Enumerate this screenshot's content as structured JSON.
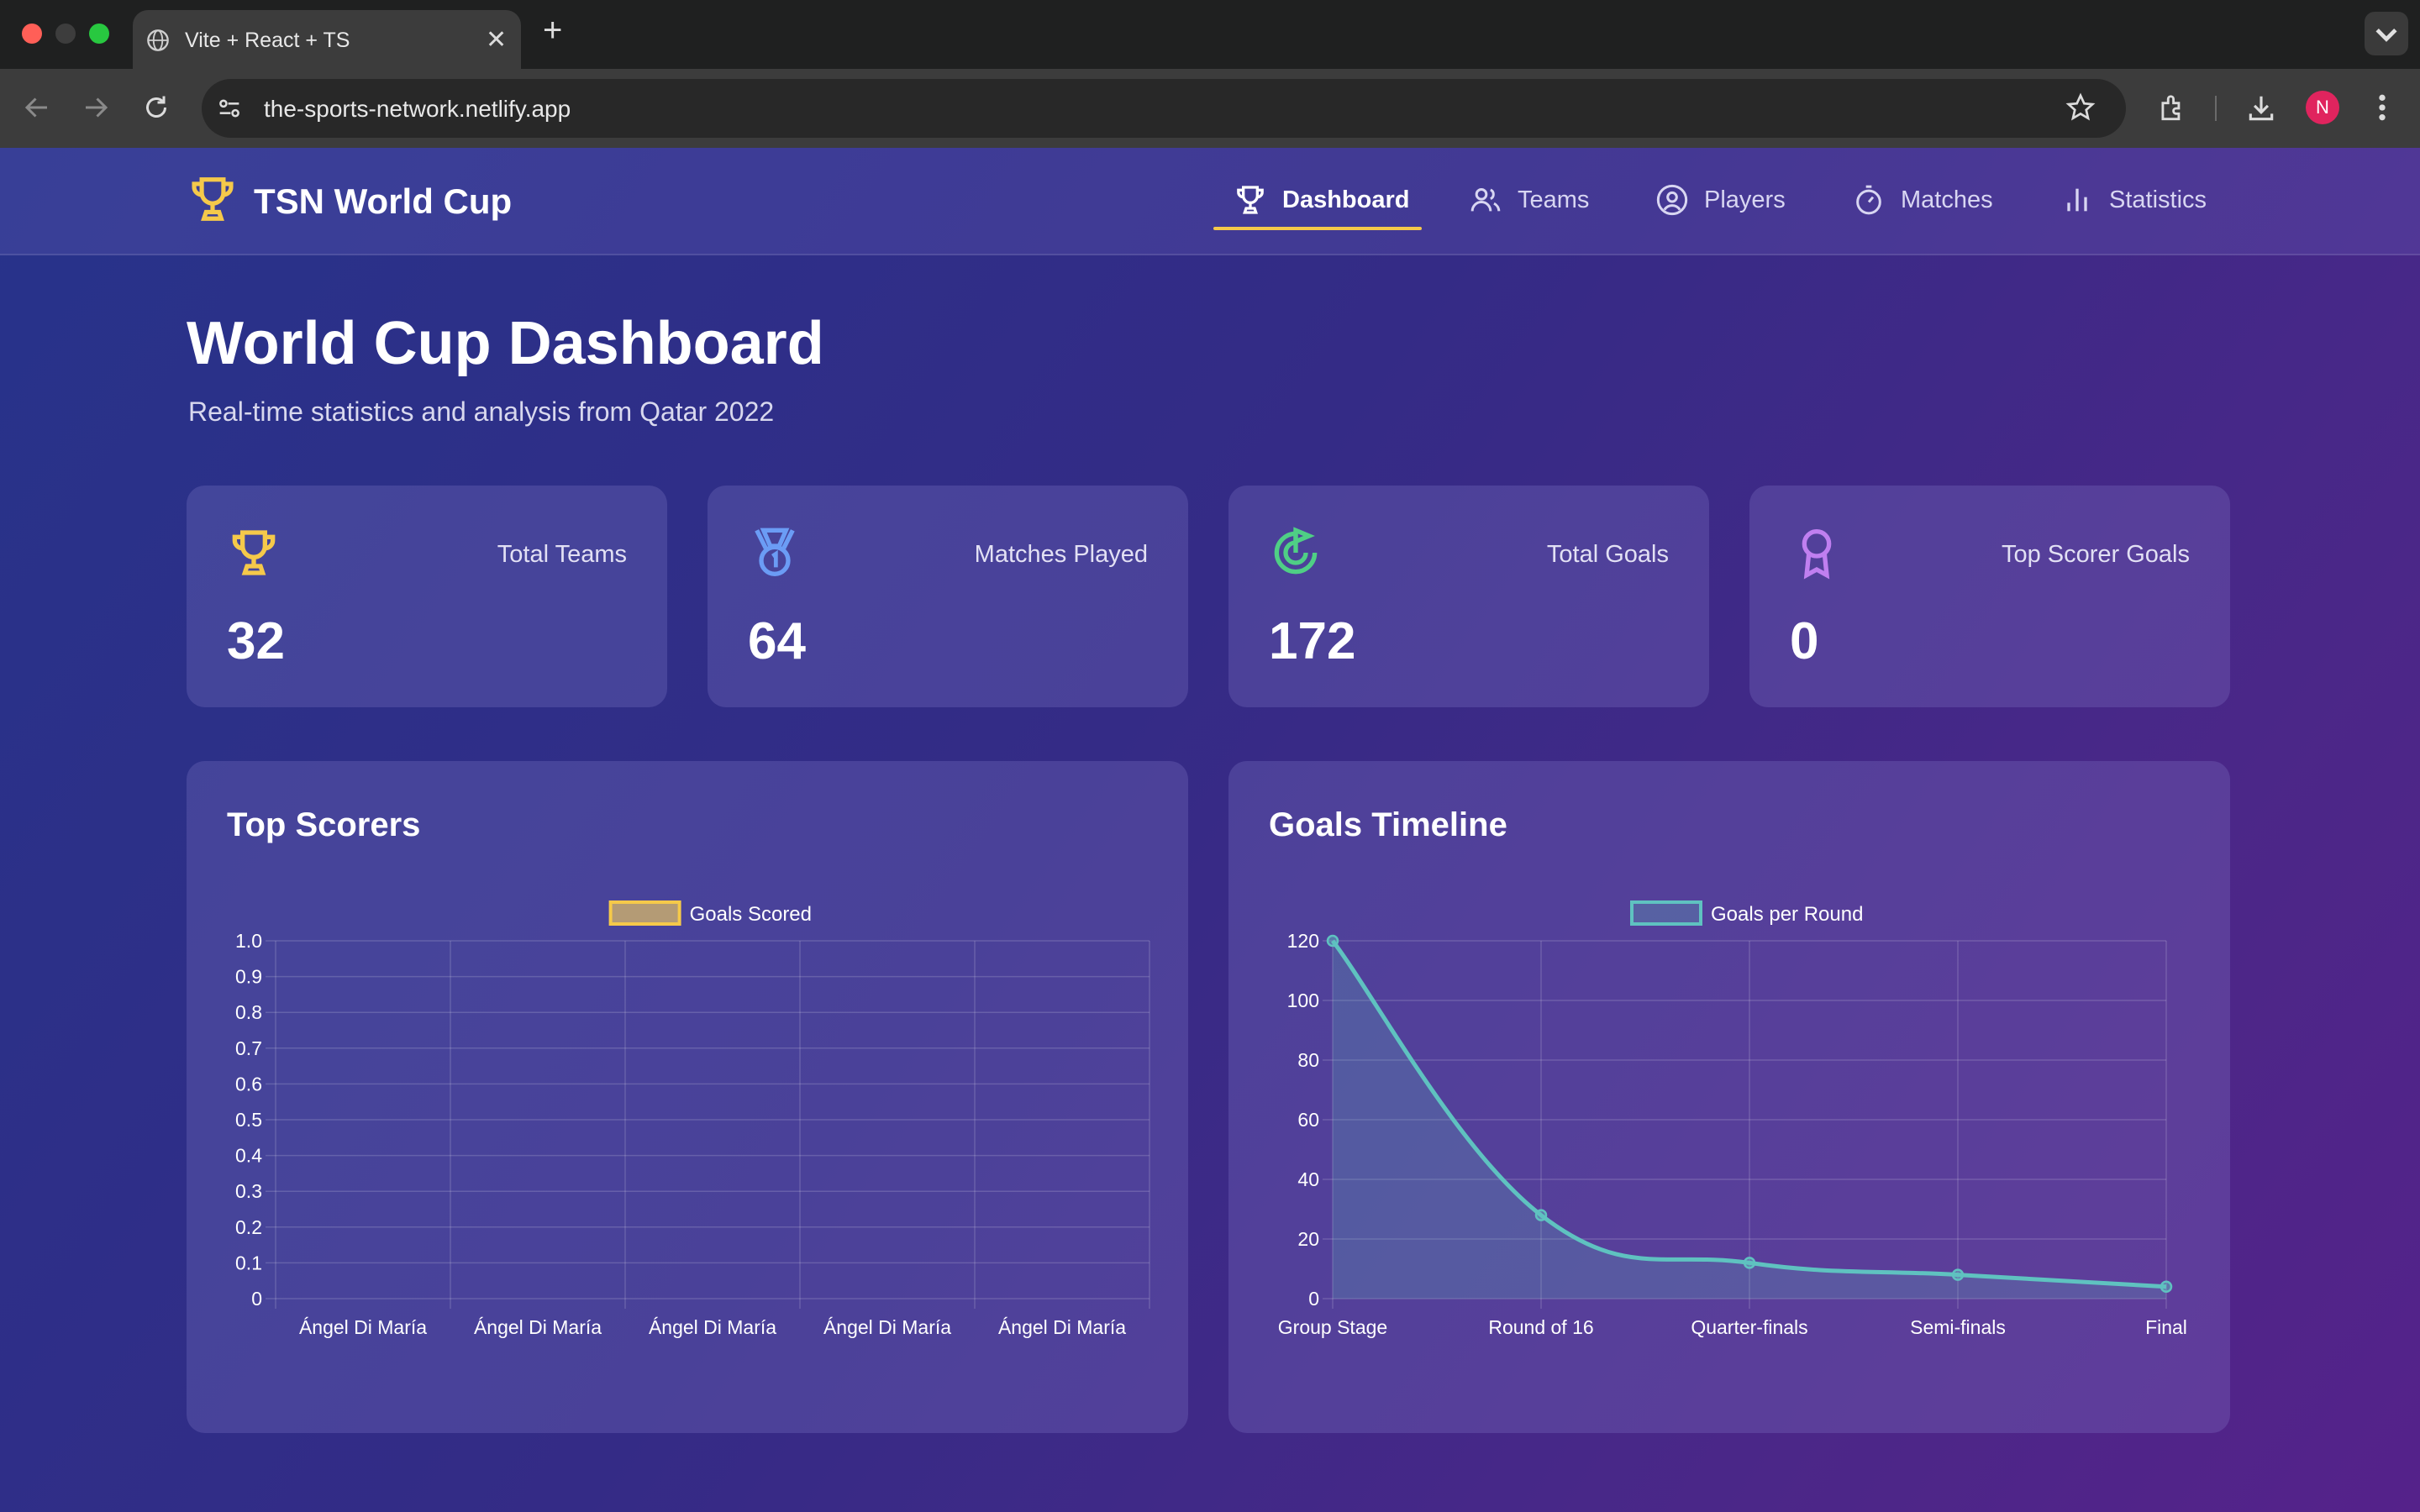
{
  "browser": {
    "tab_title": "Vite + React + TS",
    "new_tab_label": "+",
    "url": "the-sports-network.netlify.app",
    "profile_initial": "N"
  },
  "header": {
    "logo_text": "TSN World Cup",
    "nav": [
      {
        "label": "Dashboard",
        "icon": "trophy-icon",
        "active": true
      },
      {
        "label": "Teams",
        "icon": "users-icon",
        "active": false
      },
      {
        "label": "Players",
        "icon": "user-circle-icon",
        "active": false
      },
      {
        "label": "Matches",
        "icon": "timer-icon",
        "active": false
      },
      {
        "label": "Statistics",
        "icon": "bar-chart-icon",
        "active": false
      }
    ],
    "accent_color": "#f5c94a"
  },
  "main": {
    "title": "World Cup Dashboard",
    "subtitle": "Real-time statistics and analysis from Qatar 2022",
    "stats": [
      {
        "label": "Total Teams",
        "value": "32",
        "icon": "trophy-icon",
        "color": "#f5c94a"
      },
      {
        "label": "Matches Played",
        "value": "64",
        "icon": "medal-icon",
        "color": "#6b9cf5"
      },
      {
        "label": "Total Goals",
        "value": "172",
        "icon": "goal-icon",
        "color": "#4fcf85"
      },
      {
        "label": "Top Scorer Goals",
        "value": "0",
        "icon": "award-icon",
        "color": "#c07ff0"
      }
    ],
    "panels": [
      {
        "title": "Top Scorers"
      },
      {
        "title": "Goals Timeline"
      }
    ]
  },
  "chart_data": [
    {
      "type": "bar",
      "title": "Top Scorers",
      "categories": [
        "Ángel Di María",
        "Ángel Di María",
        "Ángel Di María",
        "Ángel Di María",
        "Ángel Di María"
      ],
      "series": [
        {
          "name": "Goals Scored",
          "values": [
            0,
            0,
            0,
            0,
            0
          ],
          "color": "#f5c94a"
        }
      ],
      "ylim": [
        0,
        1.0
      ],
      "yticks": [
        "1.0",
        "0.9",
        "0.8",
        "0.7",
        "0.6",
        "0.5",
        "0.4",
        "0.3",
        "0.2",
        "0.1",
        "0"
      ],
      "grid": true,
      "legend": "top-center"
    },
    {
      "type": "area",
      "title": "Goals Timeline",
      "categories": [
        "Group Stage",
        "Round of 16",
        "Quarter-finals",
        "Semi-finals",
        "Final"
      ],
      "series": [
        {
          "name": "Goals per Round",
          "values": [
            120,
            28,
            12,
            8,
            4
          ],
          "color": "#5fc2c0"
        }
      ],
      "ylim": [
        0,
        120
      ],
      "yticks": [
        "120",
        "100",
        "80",
        "60",
        "40",
        "20",
        "0"
      ],
      "grid": true,
      "legend": "top-center"
    }
  ]
}
